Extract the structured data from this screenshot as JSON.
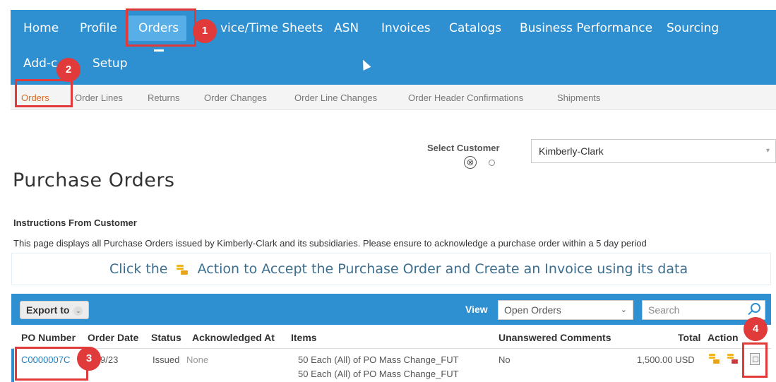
{
  "topnav": {
    "items": [
      "Home",
      "Profile",
      "Orders",
      "vice/Time Sheets",
      "ASN",
      "Invoices",
      "Catalogs",
      "Business Performance",
      "Sourcing"
    ],
    "row2": [
      "Add-c",
      "Setup"
    ]
  },
  "subnav": {
    "items": [
      "Orders",
      "Order Lines",
      "Returns",
      "Order Changes",
      "Order Line Changes",
      "Order Header Confirmations",
      "Shipments"
    ]
  },
  "customer": {
    "label": "Select Customer",
    "x_glyph": "⊗",
    "selected": "Kimberly-Clark",
    "caret": "▾"
  },
  "page": {
    "title": "Purchase Orders",
    "instructions_heading": "Instructions From Customer",
    "instructions_text": "This page displays all Purchase Orders issued by Kimberly-Clark and its subsidiaries. Please ensure to acknowledge a purchase order within a 5 day period",
    "banner_before": "Click the",
    "banner_after": "Action to Accept the Purchase Order and Create an Invoice using its data"
  },
  "toolbar": {
    "export_label": "Export to",
    "export_chevron": "⌄",
    "view_label": "View",
    "view_selected": "Open Orders",
    "view_caret": "⌄",
    "search_placeholder": "Search"
  },
  "table": {
    "headers": [
      "PO Number",
      "Order Date",
      "Status",
      "Acknowledged At",
      "Items",
      "Unanswered Comments",
      "Total",
      "Action"
    ],
    "row": {
      "po_number": "C0000007C",
      "order_date": "9/23",
      "status": "Issued",
      "acknowledged": "None",
      "items": [
        "50 Each (All) of PO Mass Change_FUT",
        "50 Each (All) of PO Mass Change_FUT"
      ],
      "comments": "No",
      "total": "1,500.00 USD"
    }
  },
  "callouts": [
    "1",
    "2",
    "3",
    "4"
  ],
  "colors": {
    "nav_blue": "#2e8fd1",
    "active_tab": "#58aee6",
    "subnav_active": "#d86b27",
    "callout_red": "#e03a3a"
  }
}
